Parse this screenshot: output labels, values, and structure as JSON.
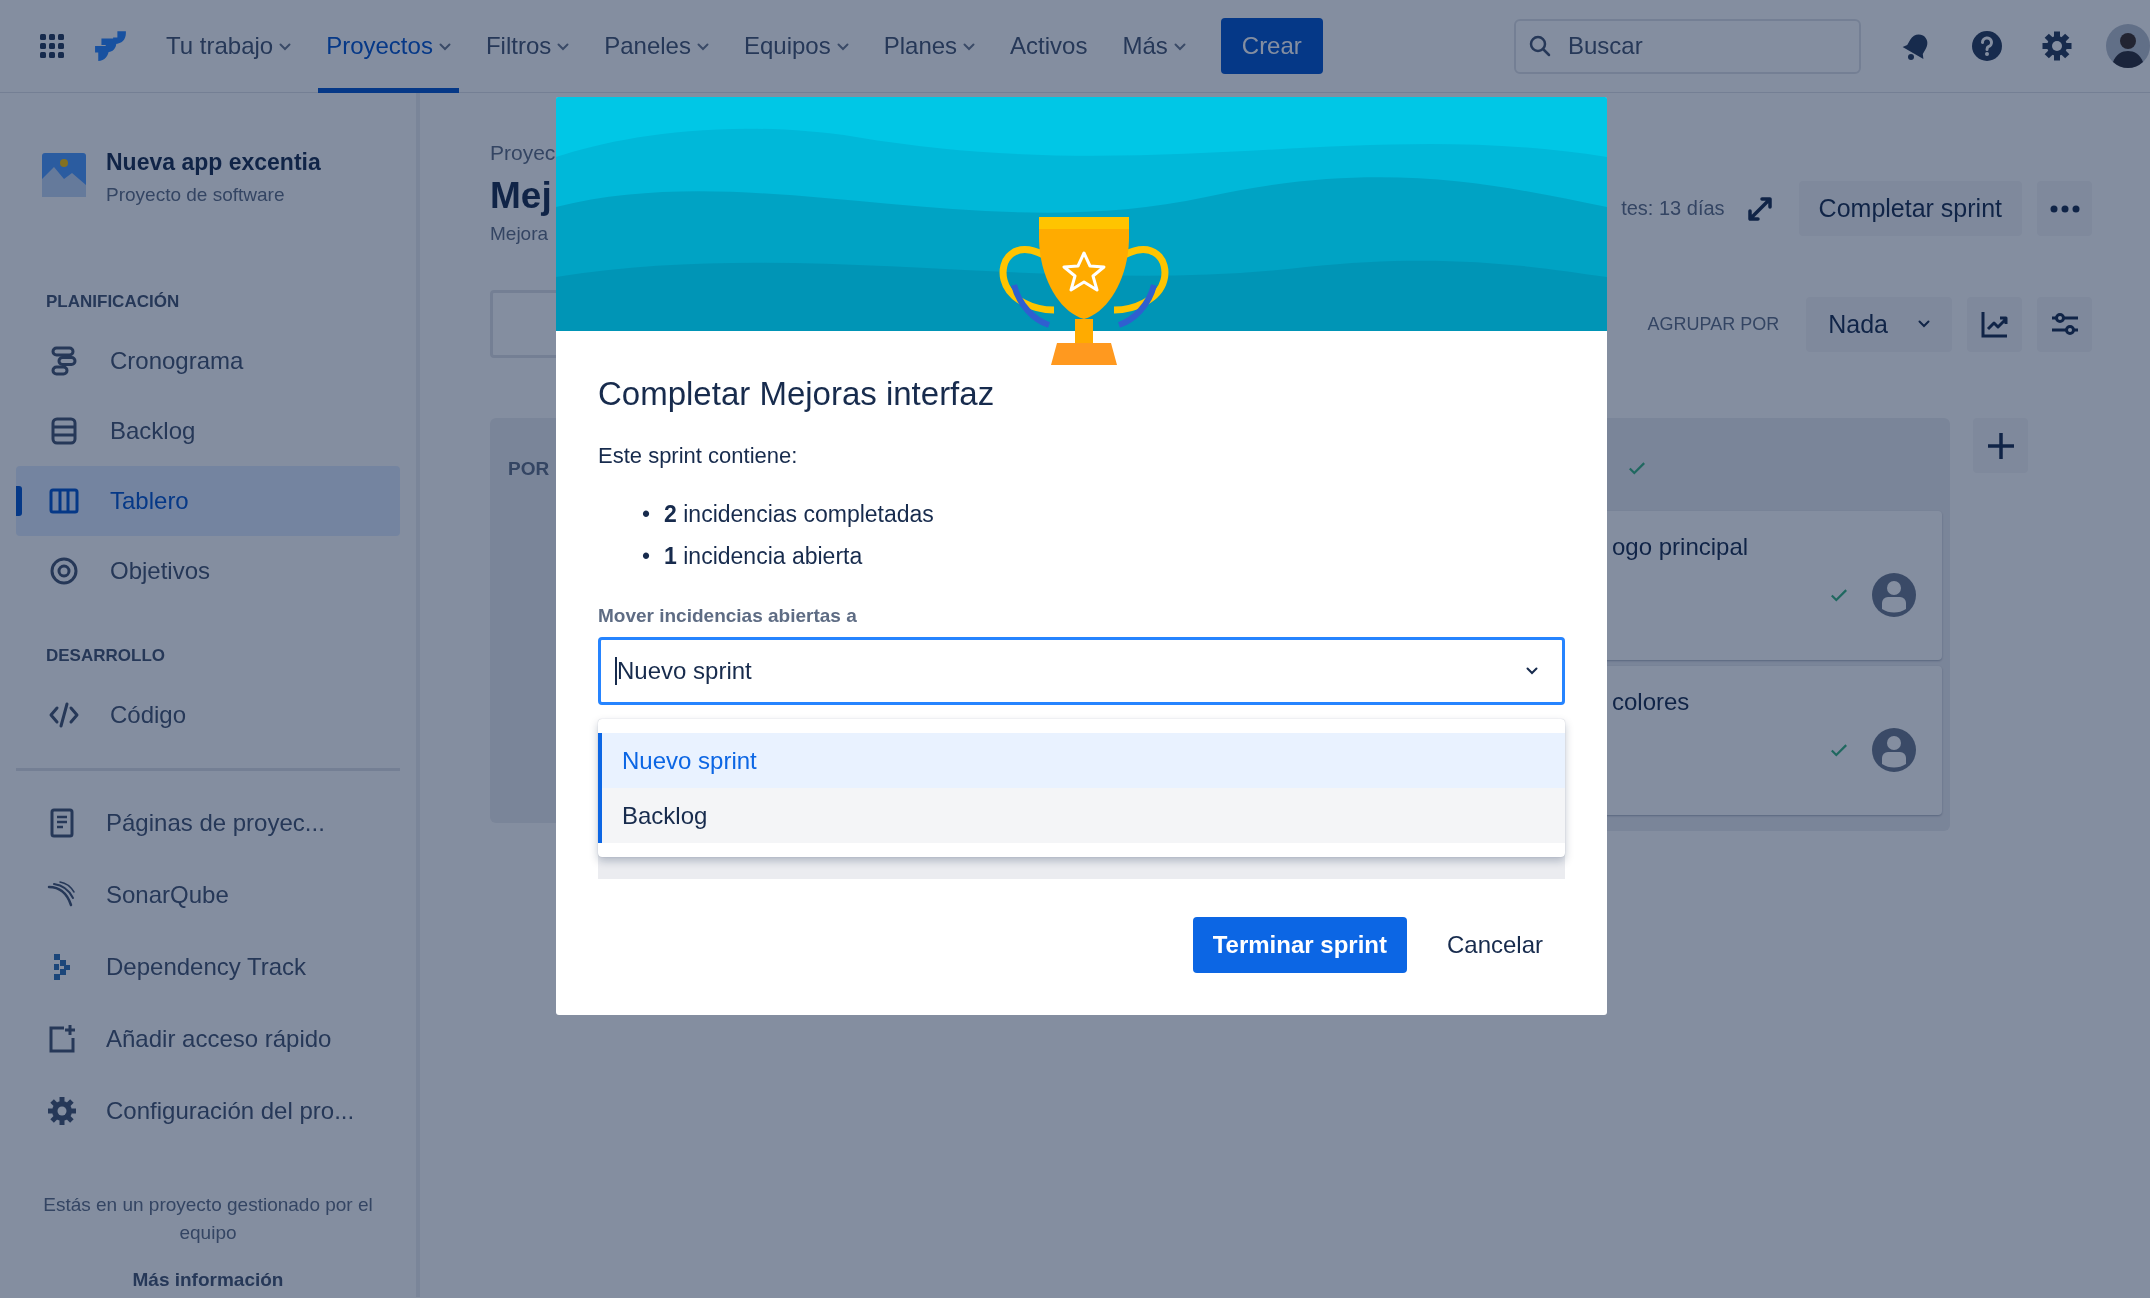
{
  "nav": {
    "items": [
      {
        "label": "Tu trabajo",
        "dropdown": true,
        "selected": false
      },
      {
        "label": "Proyectos",
        "dropdown": true,
        "selected": true
      },
      {
        "label": "Filtros",
        "dropdown": true,
        "selected": false
      },
      {
        "label": "Paneles",
        "dropdown": true,
        "selected": false
      },
      {
        "label": "Equipos",
        "dropdown": true,
        "selected": false
      },
      {
        "label": "Planes",
        "dropdown": true,
        "selected": false
      },
      {
        "label": "Activos",
        "dropdown": false,
        "selected": false
      },
      {
        "label": "Más",
        "dropdown": true,
        "selected": false
      }
    ],
    "create_button": "Crear",
    "search": {
      "placeholder": "Buscar"
    }
  },
  "sidebar": {
    "project": {
      "name": "Nueva app excentia",
      "type": "Proyecto de software"
    },
    "sections": [
      {
        "heading": "PLANIFICACIÓN",
        "items": [
          {
            "label": "Cronograma",
            "selected": false
          },
          {
            "label": "Backlog",
            "selected": false
          },
          {
            "label": "Tablero",
            "selected": true
          },
          {
            "label": "Objetivos",
            "selected": false
          }
        ]
      },
      {
        "heading": "DESARROLLO",
        "items": [
          {
            "label": "Código",
            "selected": false
          }
        ]
      }
    ],
    "links": [
      "Páginas de proyec...",
      "SonarQube",
      "Dependency Track",
      "Añadir acceso rápido",
      "Configuración del pro..."
    ],
    "footer": {
      "text": "Estás en un proyecto gestionado por el equipo",
      "link": "Más información"
    }
  },
  "board": {
    "breadcrumb": "Proyec",
    "title": "Mej",
    "subtitle": "Mejora",
    "time_left": "tes: 13 días",
    "complete_button": "Completar sprint",
    "group_by_label": "AGRUPAR POR",
    "group_by": "Nada",
    "columns": [
      {
        "title": "POR"
      },
      {
        "done": true,
        "cards": [
          {
            "title": "ogo principal",
            "done": true
          },
          {
            "title": "colores",
            "done": true
          }
        ]
      }
    ]
  },
  "modal": {
    "title": "Completar Mejoras interfaz",
    "intro": "Este sprint contiene:",
    "bullet": "•",
    "stats": [
      "**2** incidencias completadas",
      "**1** incidencia abierta"
    ],
    "field_label": "Mover incidencias abiertas a",
    "value": "Nuevo sprint",
    "options": [
      {
        "label": "Nuevo sprint",
        "selected": true
      },
      {
        "label": "Backlog",
        "selected": false
      }
    ],
    "primary_button": "Terminar sprint",
    "cancel_button": "Cancelar"
  }
}
